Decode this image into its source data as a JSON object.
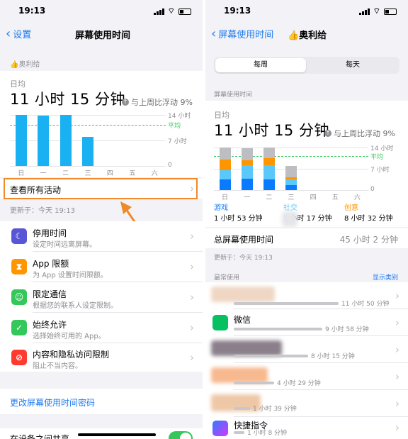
{
  "left": {
    "status_time": "19:13",
    "nav": {
      "back_label": "设置",
      "title": "屏幕使用时间"
    },
    "profile": "👍奥利给",
    "summary": {
      "avg_label": "日均",
      "big_time": "11 小时 15 分钟",
      "compare": "与上周比浮动 9%"
    },
    "chart_data": {
      "type": "bar",
      "categories": [
        "日",
        "一",
        "二",
        "三",
        "四",
        "五",
        "六"
      ],
      "values": [
        14.2,
        13.8,
        14.0,
        8.0,
        0,
        0,
        0
      ],
      "y_tick_labels": [
        "14 小时",
        "7 小时",
        "0"
      ],
      "average_label": "平均",
      "average": 11.25,
      "ylim": [
        0,
        14
      ],
      "color": "#1ab1f2"
    },
    "view_all": "查看所有活动",
    "updated": "更新于：今天 19:13",
    "settings": [
      {
        "title": "停用时间",
        "sub": "设定时间远离屏幕。",
        "icon": "moon-icon",
        "color": "#5856d6"
      },
      {
        "title": "App 限额",
        "sub": "为 App 设置时间限额。",
        "icon": "hourglass-icon",
        "color": "#ff9500"
      },
      {
        "title": "限定通信",
        "sub": "根据您的联系人设定限制。",
        "icon": "person-icon",
        "color": "#34c759"
      },
      {
        "title": "始终允许",
        "sub": "选择始终可用的 App。",
        "icon": "check-icon",
        "color": "#34c759"
      },
      {
        "title": "内容和隐私访问限制",
        "sub": "阻止不当内容。",
        "icon": "block-icon",
        "color": "#ff3b30"
      }
    ],
    "change_passcode": "更改屏幕使用时间密码",
    "share_across": "在设备之间共享"
  },
  "right": {
    "status_time": "19:13",
    "nav": {
      "back_label": "屏幕使用时间",
      "title": "👍奥利给"
    },
    "segments": {
      "week": "每周",
      "day": "每天"
    },
    "section_title": "屏幕使用时间",
    "summary": {
      "avg_label": "日均",
      "big_time": "11 小时 15 分钟",
      "compare": "与上周比浮动 9%"
    },
    "chart_data": {
      "type": "bar",
      "categories": [
        "日",
        "一",
        "二",
        "三",
        "四",
        "五",
        "六"
      ],
      "series": [
        {
          "name": "游戏",
          "values": [
            3.5,
            3.8,
            3.6,
            1.6,
            0,
            0,
            0
          ],
          "color": "#0a7aff"
        },
        {
          "name": "社交",
          "values": [
            3.2,
            4.3,
            4.5,
            2.0,
            0,
            0,
            0
          ],
          "color": "#5ac8fa"
        },
        {
          "name": "创意",
          "values": [
            3.4,
            1.7,
            2.5,
            0.6,
            0,
            0,
            0
          ],
          "color": "#ff9500"
        },
        {
          "name": "",
          "values": [
            4.1,
            4.0,
            3.4,
            3.8,
            0,
            0,
            0
          ],
          "color": "#bdbdc2"
        }
      ],
      "y_tick_labels": [
        "14 小时",
        "7 小时",
        "0"
      ],
      "average_label": "平均",
      "average": 11.25,
      "ylim": [
        0,
        14
      ]
    },
    "legend": [
      {
        "name": "游戏",
        "time": "1 小时 53 分钟",
        "color": "#0a7aff"
      },
      {
        "name": "社交",
        "time": "1 小时 17 分钟",
        "color": "#5ac8fa"
      },
      {
        "name": "创意",
        "time": "8 小时 32 分钟",
        "color": "#ff9500"
      }
    ],
    "total_label": "总屏幕使用时间",
    "total_value": "45 小时 2 分钟",
    "updated": "更新于：今天 19:13",
    "most_used": "最常使用",
    "show_categories": "显示类别",
    "apps": [
      {
        "name": "",
        "time": "11 小时 50 分钟",
        "usage": 0.78,
        "icon_color": "#f0c9a6"
      },
      {
        "name": "微信",
        "time": "9 小时 58 分钟",
        "usage": 0.66,
        "icon_color": "#07c160"
      },
      {
        "name": "",
        "time": "8 小时 15 分钟",
        "usage": 0.55,
        "icon_color": "#7a6e7a"
      },
      {
        "name": "",
        "time": "4 小时 29 分钟",
        "usage": 0.3,
        "icon_color": "#f5a77a"
      },
      {
        "name": "",
        "time": "1 小时 39 分钟",
        "usage": 0.12,
        "icon_color": "#e8b895"
      },
      {
        "name": "快捷指令",
        "time": "1 小时 8 分钟",
        "usage": 0.08,
        "icon_color": "#4b3fcf"
      }
    ]
  }
}
